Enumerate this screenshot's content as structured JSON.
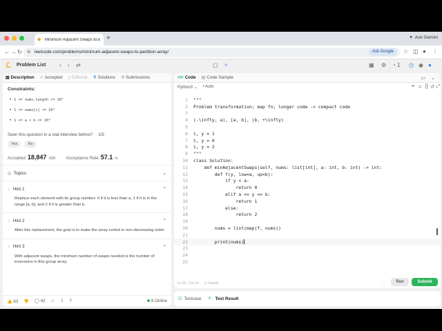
{
  "browser": {
    "tab_title": "Minimum Adjacent Swaps to",
    "url": "leetcode.com/problems/minimum-adjacent-swaps-to-partition-array/",
    "ask_gemini": "Ask Gemini",
    "ask_google": "Ask Google",
    "colors": {
      "red": "#ff5f57",
      "yellow": "#febc2e",
      "green": "#28c840"
    }
  },
  "header": {
    "problem_list": "Problem List"
  },
  "left": {
    "tabs": [
      {
        "label": "Description",
        "icon": "description-icon",
        "state": "active"
      },
      {
        "label": "Accepted",
        "icon": "check-icon",
        "state": "normal"
      },
      {
        "label": "Editorial",
        "icon": "book-icon",
        "state": "disabled"
      },
      {
        "label": "Solutions",
        "icon": "flask-icon",
        "state": "normal"
      },
      {
        "label": "Submissions",
        "icon": "history-icon",
        "state": "normal"
      }
    ],
    "constraints_title": "Constraints:",
    "constraints": [
      "1 <= nums.length <= 10⁵",
      "1 <= nums[i] <= 10⁹",
      "1 <= a < b <= 10⁹"
    ],
    "seen_question": "Seen this question in a real interview before?",
    "seen_count": "1/5",
    "yes": "Yes",
    "no": "No",
    "accepted_label": "Accepted",
    "accepted_value": "18,847",
    "accepted_total": "/33K",
    "rate_label": "Acceptance Rate",
    "rate_value": "57.1",
    "rate_unit": "%",
    "topics": "Topics",
    "hints": [
      {
        "title": "Hint 1",
        "body": "Replace each element with its group number: 0 if it is less than a, 1 if it is in the range [a, b], and 2 if it is greater than b."
      },
      {
        "title": "Hint 2",
        "body": "After this replacement, the goal is to make the array sorted in non-decreasing order."
      },
      {
        "title": "Hint 3",
        "body": "With adjacent swaps, the minimum number of swaps needed is the number of inversions in this group array."
      }
    ],
    "footer": {
      "likes": "63",
      "comments": "42",
      "online": "8 Online"
    }
  },
  "right": {
    "tabs": [
      {
        "label": "Code",
        "state": "active"
      },
      {
        "label": "Code Sample",
        "state": "normal"
      }
    ],
    "language": "Python3",
    "mode": "Auto",
    "code_lines": [
      "\"\"\"",
      "Problem transformation; map fn; longer code -> compact code",
      "",
      "(-\\infty, a), [a, b], (b, +\\infty)",
      "",
      "i, y = 1",
      "i, y = 0",
      "i, y = 2",
      "\"\"\"",
      "class Solution:",
      "    def minAdjacentSwaps(self, nums: list[int], a: int, b: int) -> int:",
      "        def f(y, low=a, up=b):",
      "            if y < a:",
      "                return 0",
      "            elif a <= y <= b:",
      "                return 1",
      "            else:",
      "                return 2",
      "",
      "        nums = list(map(f, nums))",
      "",
      "        print(nums)",
      "",
      "",
      ""
    ],
    "current_line": 22,
    "status": "Ln 22, Col 19",
    "saved": "Saved",
    "run": "Run",
    "submit": "Submit"
  },
  "bottom": {
    "testcase": "Testcase",
    "test_result": "Test Result"
  }
}
